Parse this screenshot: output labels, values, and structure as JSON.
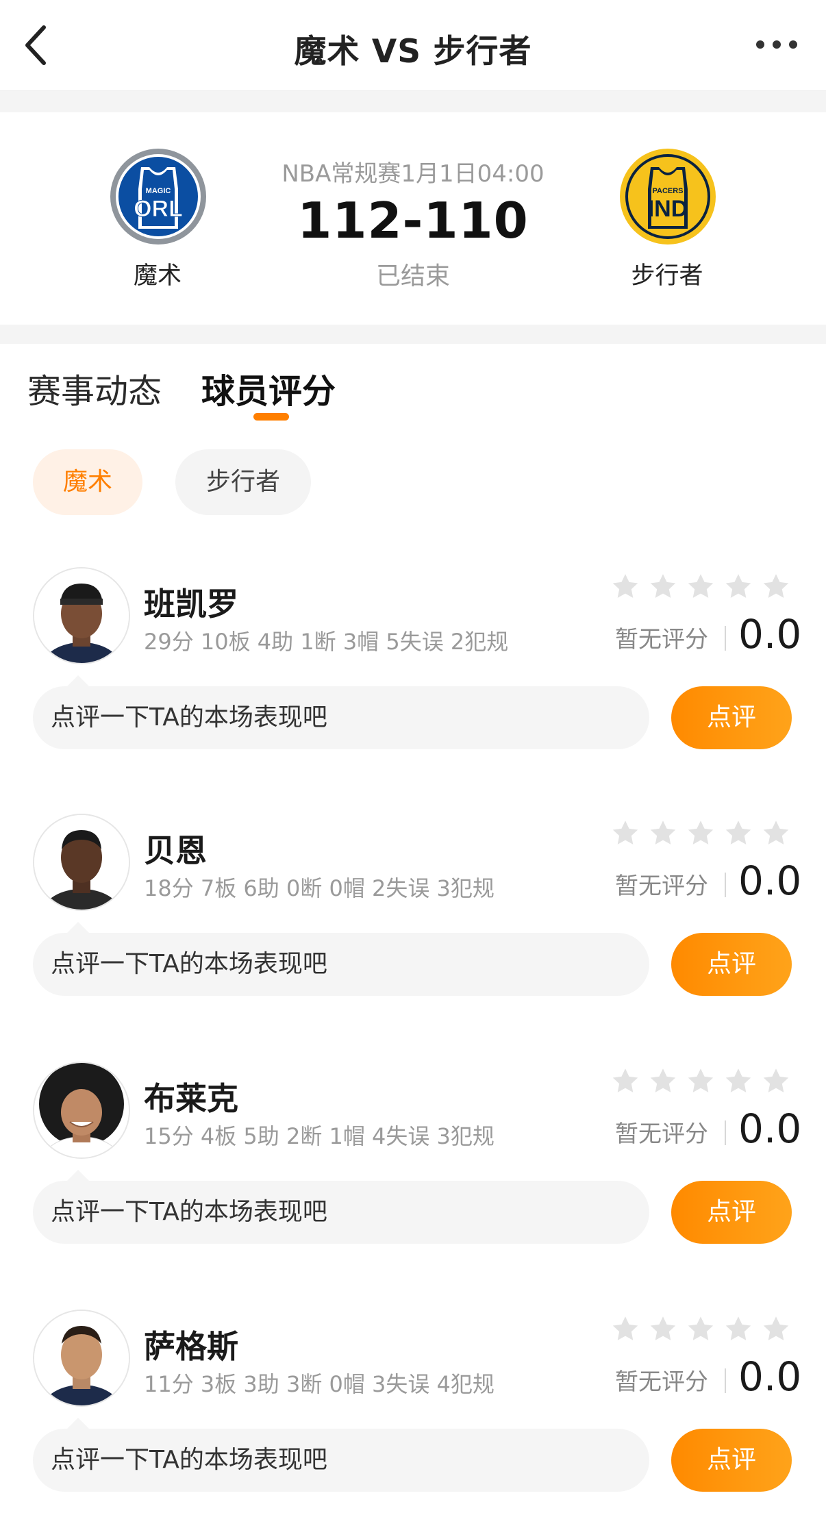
{
  "header": {
    "title": "魔术 VS 步行者"
  },
  "match": {
    "info": "NBA常规赛1月1日04:00",
    "score": "112-110",
    "status": "已结束",
    "home": {
      "name": "魔术",
      "logo_top": "MAGIC",
      "logo_text": "ORL"
    },
    "away": {
      "name": "步行者",
      "logo_top": "PACERS",
      "logo_text": "IND"
    }
  },
  "tabs": [
    {
      "label": "赛事动态",
      "active": false
    },
    {
      "label": "球员评分",
      "active": true
    }
  ],
  "team_filter": [
    {
      "label": "魔术",
      "active": true
    },
    {
      "label": "步行者",
      "active": false
    }
  ],
  "players": [
    {
      "name": "班凯罗",
      "stats": "29分 10板 4助 1断 3帽 5失误 2犯规",
      "rating_label": "暂无评分",
      "rating": "0.0",
      "stars": 0,
      "comment_placeholder": "点评一下TA的本场表现吧",
      "comment_button": "点评"
    },
    {
      "name": "贝恩",
      "stats": "18分 7板 6助 0断 0帽 2失误 3犯规",
      "rating_label": "暂无评分",
      "rating": "0.0",
      "stars": 0,
      "comment_placeholder": "点评一下TA的本场表现吧",
      "comment_button": "点评"
    },
    {
      "name": "布莱克",
      "stats": "15分 4板 5助 2断 1帽 4失误 3犯规",
      "rating_label": "暂无评分",
      "rating": "0.0",
      "stars": 0,
      "comment_placeholder": "点评一下TA的本场表现吧",
      "comment_button": "点评"
    },
    {
      "name": "萨格斯",
      "stats": "11分 3板 3助 3断 0帽 3失误 4犯规",
      "rating_label": "暂无评分",
      "rating": "0.0",
      "stars": 0,
      "comment_placeholder": "点评一下TA的本场表现吧",
      "comment_button": "点评"
    }
  ],
  "colors": {
    "accent": "#ff7f00",
    "magic_blue": "#0b4ea2",
    "pacers_gold": "#f6c21c",
    "pacers_navy": "#0a2240",
    "star_empty": "#e2e2e2"
  },
  "icons": {
    "back": "chevron-left-icon",
    "more": "more-dots-icon",
    "star": "star-icon"
  }
}
